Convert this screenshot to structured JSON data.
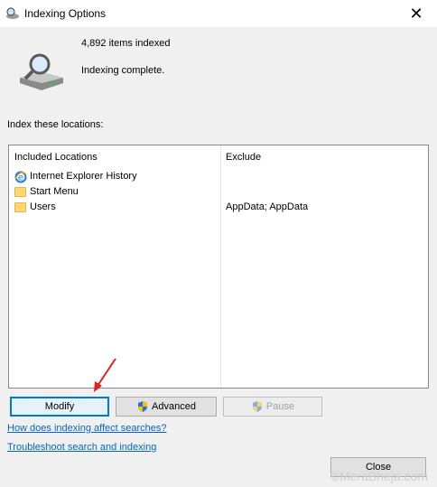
{
  "window": {
    "title": "Indexing Options",
    "close_glyph": "✕"
  },
  "status": {
    "items_indexed": "4,892 items indexed",
    "state": "Indexing complete."
  },
  "locations": {
    "label": "Index these locations:",
    "col_included": "Included Locations",
    "col_exclude": "Exclude",
    "rows": [
      {
        "name": "Internet Explorer History",
        "exclude": "",
        "icon": "ie-icon"
      },
      {
        "name": "Start Menu",
        "exclude": "",
        "icon": "folder-icon"
      },
      {
        "name": "Users",
        "exclude": "AppData; AppData",
        "icon": "folder-icon"
      }
    ]
  },
  "buttons": {
    "modify": "Modify",
    "advanced": "Advanced",
    "pause": "Pause",
    "close": "Close"
  },
  "links": {
    "how_indexing": "How does indexing affect searches?",
    "troubleshoot": "Troubleshoot search and indexing"
  },
  "watermark": "©MeraBheja.com",
  "colors": {
    "link": "#0066cc",
    "focus": "#0078d7",
    "annotation": "#e02020"
  }
}
